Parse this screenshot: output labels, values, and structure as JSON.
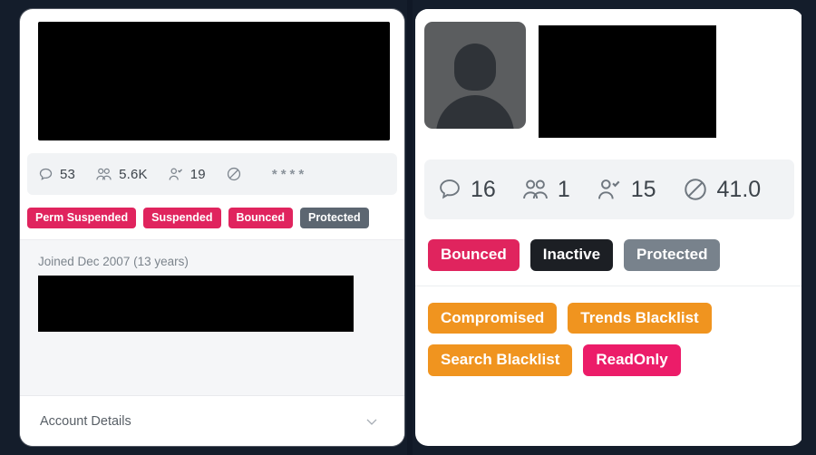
{
  "theme": {
    "page_background": "#141d2b",
    "panel_background": "#ffffff",
    "strip_background": "#f1f3f5",
    "crimson": "#e0245e",
    "pink": "#ec1c69",
    "slate": "#5c6671",
    "dark": "#1c1f24",
    "orange": "#f0941f",
    "muted_text": "#7c848c"
  },
  "left_panel": {
    "name": "account-card-left",
    "redacted_header": "",
    "stats": [
      {
        "icon": "comment-icon",
        "label": "tweets",
        "value": "53"
      },
      {
        "icon": "followers-icon",
        "label": "followers",
        "value": "5.6K"
      },
      {
        "icon": "following-check-icon",
        "label": "following",
        "value": "19"
      },
      {
        "icon": "blocked-icon",
        "label": "blocked",
        "value": ""
      }
    ],
    "overflow_dots": "****",
    "badges": [
      {
        "label": "Perm Suspended",
        "color": "#e0245e"
      },
      {
        "label": "Suspended",
        "color": "#e0245e"
      },
      {
        "label": "Bounced",
        "color": "#e0245e"
      },
      {
        "label": "Protected",
        "color": "#5c6671"
      }
    ],
    "joined_text": "Joined Dec 2007 (13 years)",
    "redacted_detail": "",
    "footer": {
      "label": "Account Details",
      "chevron": "chevron-down-icon"
    }
  },
  "right_panel": {
    "name": "account-card-right",
    "avatar": "default-avatar-icon",
    "redacted_name": "",
    "stats": [
      {
        "icon": "comment-icon",
        "label": "tweets",
        "value": "16"
      },
      {
        "icon": "followers-icon",
        "label": "followers",
        "value": "1"
      },
      {
        "icon": "following-check-icon",
        "label": "following",
        "value": "15"
      },
      {
        "icon": "blocked-icon",
        "label": "blocked",
        "value": "41.0"
      }
    ],
    "badges_row1": [
      {
        "label": "Bounced",
        "color": "#e0245e"
      },
      {
        "label": "Inactive",
        "color": "#1c1f24"
      },
      {
        "label": "Protected",
        "color": "#78828c"
      }
    ],
    "badges_row2": [
      {
        "label": "Compromised",
        "color": "#f0941f"
      },
      {
        "label": "Trends Blacklist",
        "color": "#f0941f"
      },
      {
        "label": "Search Blacklist",
        "color": "#f0941f"
      },
      {
        "label": "ReadOnly",
        "color": "#ec1c69"
      }
    ]
  }
}
